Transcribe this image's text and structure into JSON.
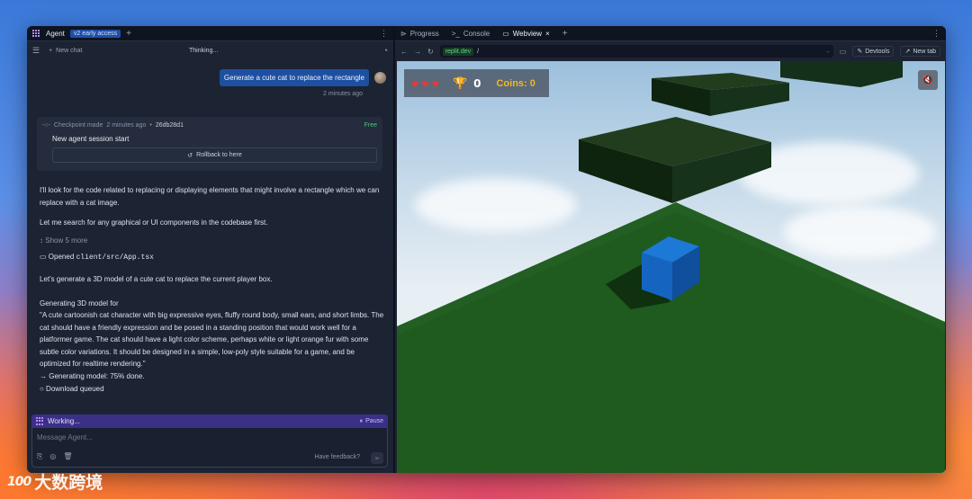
{
  "agent_panel": {
    "tab_title": "Agent",
    "badge": "v2 early access",
    "toolbar": {
      "new_chat": "New chat",
      "status": "Thinking..."
    },
    "user_message": "Generate a cute cat to replace the rectangle",
    "user_message_time": "2 minutes ago",
    "checkpoint": {
      "made_label": "Checkpoint made",
      "time": "2 minutes ago",
      "separator": "•",
      "hash": "26db28d1",
      "price": "Free",
      "title": "New agent session start",
      "rollback_label": "Rollback to here"
    },
    "messages": {
      "p1": "I'll look for the code related to replacing or displaying elements that might involve a rectangle which we can replace with a cat image.",
      "p2": "Let me search for any graphical or UI components in the codebase first.",
      "show_more": "Show 5 more",
      "opened_label": "Opened",
      "opened_file": "client/src/App.tsx",
      "p3": "Let's generate a 3D model of a cute cat to replace the current player box.",
      "gen_title": "Generating 3D model for",
      "gen_prompt": "\"A cute cartoonish cat character with big expressive eyes, fluffy round body, small ears, and short limbs. The cat should have a friendly expression and be posed in a standing position that would work well for a platformer game. The cat should have a light color scheme, perhaps white or light orange fur with some subtle color variations. It should be designed in a simple, low-poly style suitable for a game, and be optimized for realtime rendering.\"",
      "progress_line": "→ Generating model: 75% done.",
      "download_line": "○ Download queued"
    },
    "working": {
      "label": "Working...",
      "pause": "Pause"
    },
    "input": {
      "placeholder": "Message Agent...",
      "feedback": "Have feedback?"
    }
  },
  "webview_panel": {
    "tabs": [
      {
        "label": "Progress",
        "icon": "progress-icon"
      },
      {
        "label": "Console",
        "icon": "console-icon"
      },
      {
        "label": "Webview",
        "icon": "monitor-icon",
        "active": true
      }
    ],
    "url": {
      "domain": "replit.dev",
      "path": "/"
    },
    "devtools_label": "Devtools",
    "newtab_label": "New tab"
  },
  "game": {
    "hearts": 3,
    "score": "0",
    "coins_label": "Coins: 0",
    "player_color": "#1565c0",
    "ground_color": "#1f5a1f",
    "platform_color": "#1d3a1a"
  },
  "watermark": {
    "logo": "100",
    "text": "大数跨境"
  }
}
